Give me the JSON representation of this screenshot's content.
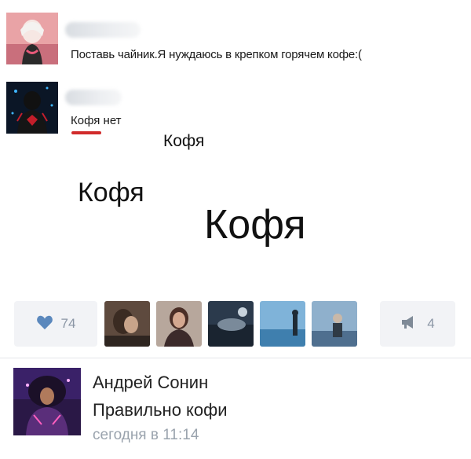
{
  "post": {
    "message_1": "Поставь чайник.Я нуждаюсь в крепком горячем кофе:(",
    "message_2_word": "Кофя",
    "message_2_rest": " нет",
    "kofya_small": "Кофя",
    "kofya_medium": "Кофя",
    "kofya_large": "Кофя"
  },
  "actions": {
    "like_icon": "heart-icon",
    "likes_count": "74",
    "share_icon": "megaphone-icon",
    "shares_count": "4"
  },
  "comment": {
    "author": "Андрей Сонин",
    "text": "Правильно кофи",
    "time": "сегодня в 11:14"
  },
  "colors": {
    "spellcheck_underline": "#d12b2b",
    "like_heart": "#5b88bd",
    "muted": "#8b96a5",
    "button_bg": "#f2f3f6"
  }
}
